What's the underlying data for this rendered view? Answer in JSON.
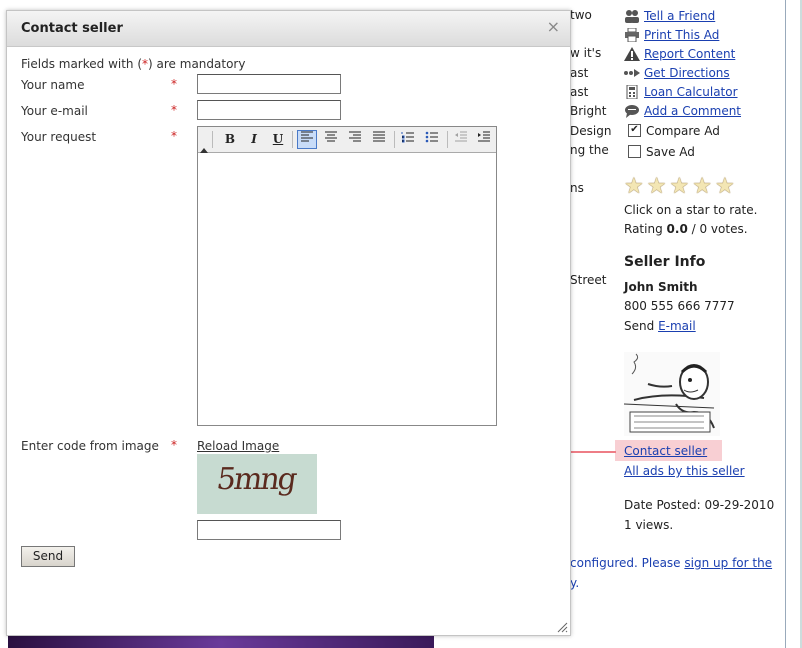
{
  "background": {
    "fragments": [
      "two",
      "w it's",
      "ast",
      "ast",
      "Bright",
      "Design",
      "ng the",
      "ns",
      "Street"
    ],
    "actions": [
      {
        "label": "Tell a Friend",
        "icon": "people-icon"
      },
      {
        "label": "Print This Ad",
        "icon": "printer-icon"
      },
      {
        "label": "Report Content",
        "icon": "warning-icon"
      },
      {
        "label": "Get Directions",
        "icon": "directions-icon"
      },
      {
        "label": "Loan Calculator",
        "icon": "calculator-icon"
      },
      {
        "label": "Add a Comment",
        "icon": "comment-icon"
      }
    ],
    "compare_label": "Compare Ad",
    "save_label": "Save Ad",
    "rating_hint": "Click on a star to rate.",
    "rating_prefix": "Rating",
    "rating_value": "0.0",
    "rating_suffix": "/ 0 votes.",
    "rating_stars": 5,
    "seller_info_title": "Seller Info",
    "seller_name": "John Smith",
    "seller_phone": "800 555 666 7777",
    "seller_send_prefix": "Send",
    "seller_email_link": "E-mail",
    "contact_seller_link": "Contact seller",
    "all_ads_link": "All ads by this seller",
    "date_posted": "Date Posted: 09-29-2010",
    "views": "1 views.",
    "config_text_prefix": "configured. Please",
    "config_link": "sign up for the",
    "config_text_end": "y."
  },
  "dialog": {
    "title": "Contact seller",
    "close_glyph": "×",
    "mandatory_prefix": "Fields marked with (",
    "mandatory_star": "*",
    "mandatory_suffix": ") are mandatory",
    "required_mark": "*",
    "name_label": "Your name",
    "email_label": "Your e-mail",
    "request_label": "Your request",
    "captcha_label": "Enter code from image",
    "reload_link": "Reload Image",
    "captcha_text": "5mng",
    "send_label": "Send",
    "toolbar": {
      "bold": "B",
      "italic": "I",
      "underline": "U"
    }
  }
}
